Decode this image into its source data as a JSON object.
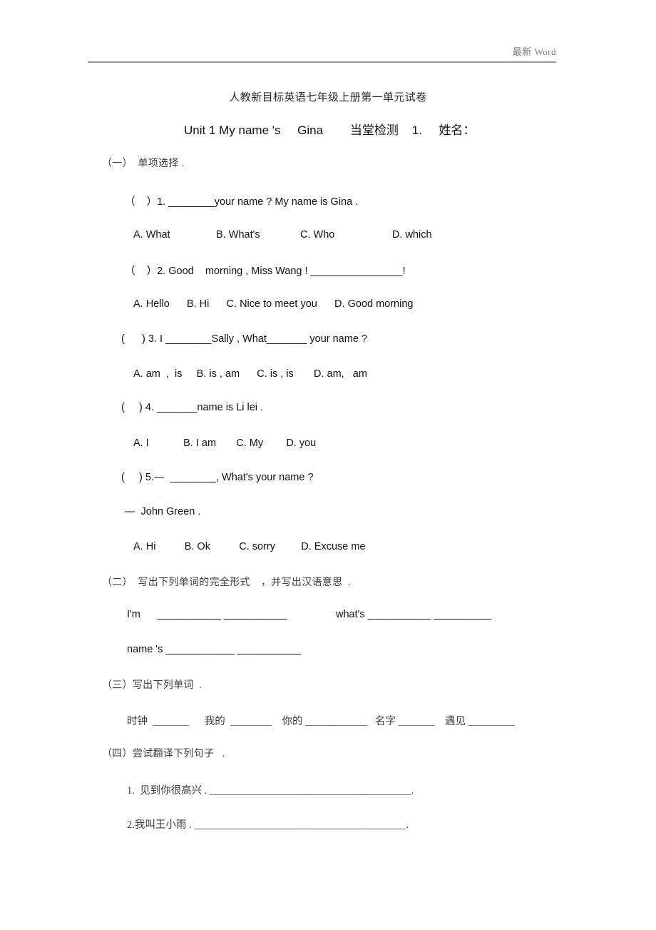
{
  "header": {
    "watermark": "最新  Word"
  },
  "title": "人教新目标英语七年级上册第一单元试卷",
  "subtitle": "Unit 1 My name 's     Gina        当堂检测    1.     姓名：",
  "sections": {
    "one": {
      "heading": "（一）  单项选择 .",
      "questions": [
        {
          "stem": "（    ）1. ________your name ? My name is Gina .",
          "options": "A. What                B. What's              C. Who                    D. which"
        },
        {
          "stem": "（    ）2. Good    morning , Miss Wang ! ________________!",
          "options": "A. Hello      B. Hi      C. Nice to meet you      D. Good morning"
        },
        {
          "stem": "(      ) 3. I ________Sally , What_______ your name ?",
          "options": "A. am  ,  is     B. is , am      C. is , is       D. am,   am"
        },
        {
          "stem": "(     ) 4. _______name is Li lei .",
          "options": "A. I            B. I am       C. My        D. you"
        },
        {
          "stem": "(     ) 5.—  ________, What's your name ?",
          "answer_line": "—  John Green .",
          "options": "A. Hi          B. Ok          C. sorry         D. Excuse me"
        }
      ]
    },
    "two": {
      "heading": "（二）  写出下列单词的完全形式    ，并写出汉语意思  .",
      "line1": "I'm      ___________ ___________                 what's ___________ __________",
      "line2": "name 's ____________ ___________"
    },
    "three": {
      "heading": "（三）写出下列单词  .",
      "words_line": "时钟  _______      我的  ________    你的 ____________   名字 _______    遇见 _________"
    },
    "four": {
      "heading": "（四）尝试翻译下列句子   .",
      "items": [
        "1.  见到你很高兴 . _______________________________________.",
        "2.我叫王小雨 . _________________________________________."
      ]
    }
  }
}
